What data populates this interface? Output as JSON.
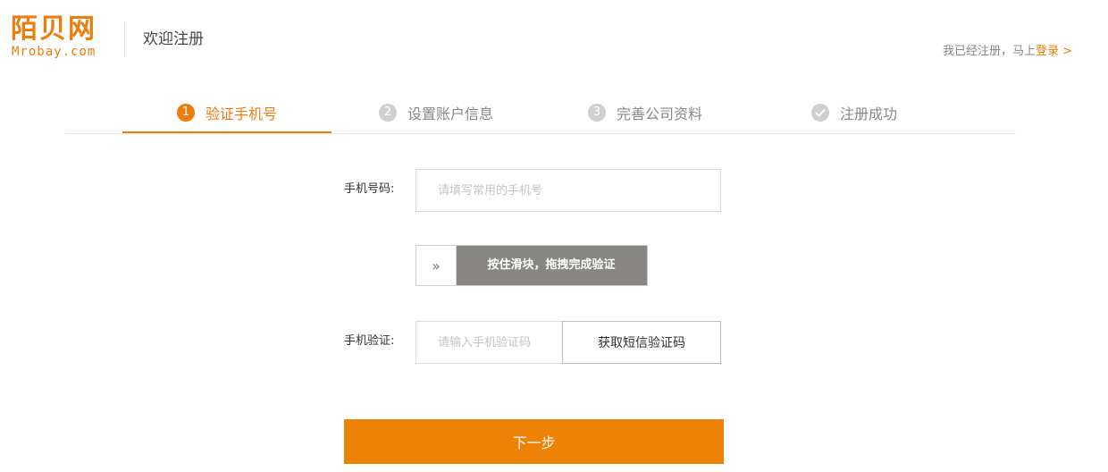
{
  "header": {
    "logo_cn": "陌贝网",
    "logo_en": "Mrobay.com",
    "title": "欢迎注册",
    "login_hint": "我已经注册，马上",
    "login_link": "登录 >"
  },
  "steps": [
    {
      "num": "1",
      "label": "验证手机号",
      "state": "active"
    },
    {
      "num": "2",
      "label": "设置账户信息",
      "state": "pending"
    },
    {
      "num": "3",
      "label": "完善公司资料",
      "state": "pending"
    },
    {
      "icon": "check-icon",
      "label": "注册成功",
      "state": "pending"
    }
  ],
  "form": {
    "phone_label": "手机号码:",
    "phone_placeholder": "请填写常用的手机号",
    "phone_value": "",
    "slider_icon": "double-chevron-right-icon",
    "slider_glyph": "»",
    "slider_text": "按住滑块，拖拽完成验证",
    "sms_label": "手机验证:",
    "sms_placeholder": "请输入手机验证码",
    "sms_value": "",
    "sms_button": "获取短信验证码",
    "next_button": "下一步"
  },
  "colors": {
    "accent": "#ee7d0e",
    "slider_fill": "#878683",
    "step_inactive": "#cfcfcf"
  }
}
